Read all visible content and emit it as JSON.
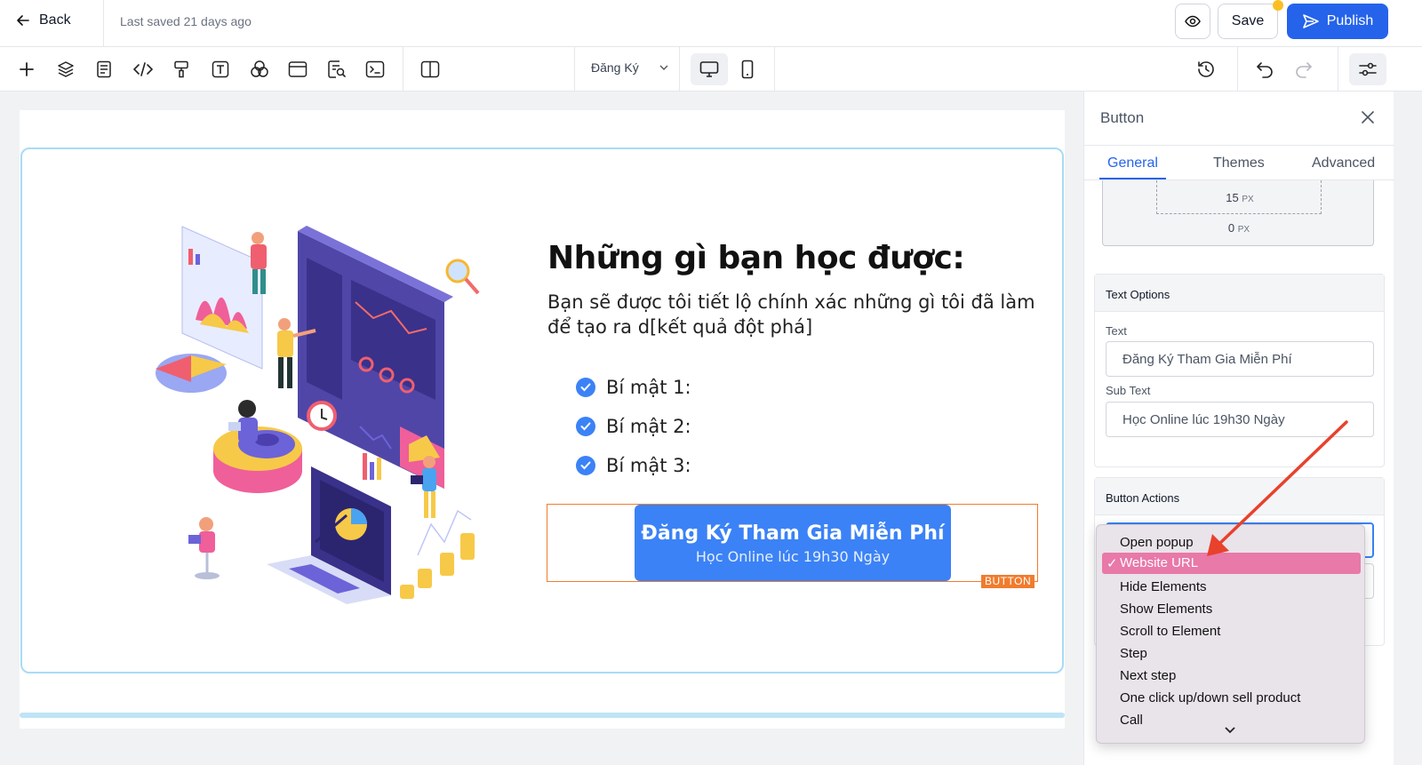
{
  "topbar": {
    "back_label": "Back",
    "last_saved": "Last saved 21 days ago",
    "save_label": "Save",
    "publish_label": "Publish"
  },
  "toolbar": {
    "page_name": "Đăng Ký",
    "icons": [
      "plus-icon",
      "layers-icon",
      "page-icon",
      "code-icon",
      "paint-roller-icon",
      "text-icon",
      "shapes-icon",
      "browser-window-icon",
      "search-page-icon",
      "terminal-icon",
      "columns-icon"
    ]
  },
  "canvas": {
    "heading": "Những gì bạn học được:",
    "subtext": "Bạn sẽ được tôi tiết lộ chính xác những gì tôi đã làm để tạo ra d[kết quả đột phá]",
    "bullets": [
      "Bí mật 1:",
      "Bí mật 2:",
      "Bí mật 3:"
    ],
    "button_main": "Đăng Ký Tham Gia Miễn Phí",
    "button_sub": "Học Online lúc 19h30 Ngày",
    "element_tag": "BUTTON"
  },
  "panel": {
    "title": "Button",
    "tabs": [
      "General",
      "Themes",
      "Advanced"
    ],
    "active_tab": "General",
    "spacing": {
      "top_value": "15",
      "bottom_value": "0",
      "unit": "PX"
    },
    "text_options": {
      "header": "Text Options",
      "text_label": "Text",
      "text_value": "Đăng Ký Tham Gia Miễn Phí",
      "subtext_label": "Sub Text",
      "subtext_value": "Học Online lúc 19h30 Ngày"
    },
    "button_actions": {
      "header": "Button Actions"
    }
  },
  "dropdown": {
    "selected": "Website URL",
    "options": [
      "Open popup",
      "Website URL",
      "Hide Elements",
      "Show Elements",
      "Scroll to Element",
      "Step",
      "Next step",
      "One click up/down sell product",
      "Call"
    ]
  },
  "colors": {
    "accent": "#2563eb",
    "cta": "#3b82f6",
    "selection_frame": "#f07c2e",
    "dropdown_highlight": "#e879a9",
    "annotation_arrow": "#e8412c"
  }
}
